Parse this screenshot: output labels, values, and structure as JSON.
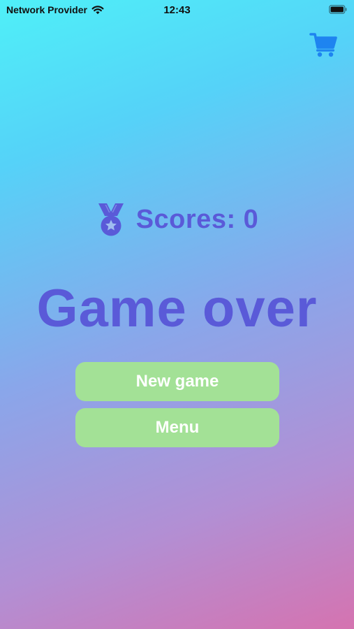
{
  "status_bar": {
    "carrier": "Network Provider",
    "time": "12:43"
  },
  "header": {
    "cart_icon": "shopping-cart-icon"
  },
  "scores": {
    "icon": "medal-icon",
    "label": "Scores: 0"
  },
  "title": "Game over",
  "buttons": {
    "new_game": "New game",
    "menu": "Menu"
  },
  "colors": {
    "title": "#5a5ad8",
    "button_bg": "#a3e196",
    "button_text": "#ffffff",
    "cart": "#1e84f0"
  }
}
